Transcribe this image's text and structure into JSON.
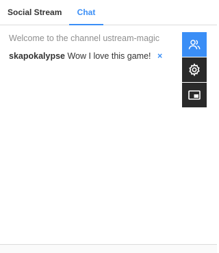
{
  "colors": {
    "accent": "#3a8ef6",
    "panel_dark": "#2a2a2a"
  },
  "tabs": [
    {
      "label": "Social Stream",
      "active": false
    },
    {
      "label": "Chat",
      "active": true
    }
  ],
  "chat": {
    "welcome": "Welcome to the channel ustream-magic",
    "messages": [
      {
        "user": "skapokalypse",
        "text": "Wow I love this game!",
        "delete_icon": "×"
      }
    ]
  },
  "side_buttons": [
    {
      "icon": "users-icon",
      "active": true
    },
    {
      "icon": "gear-icon",
      "active": false
    },
    {
      "icon": "popout-icon",
      "active": false
    }
  ]
}
